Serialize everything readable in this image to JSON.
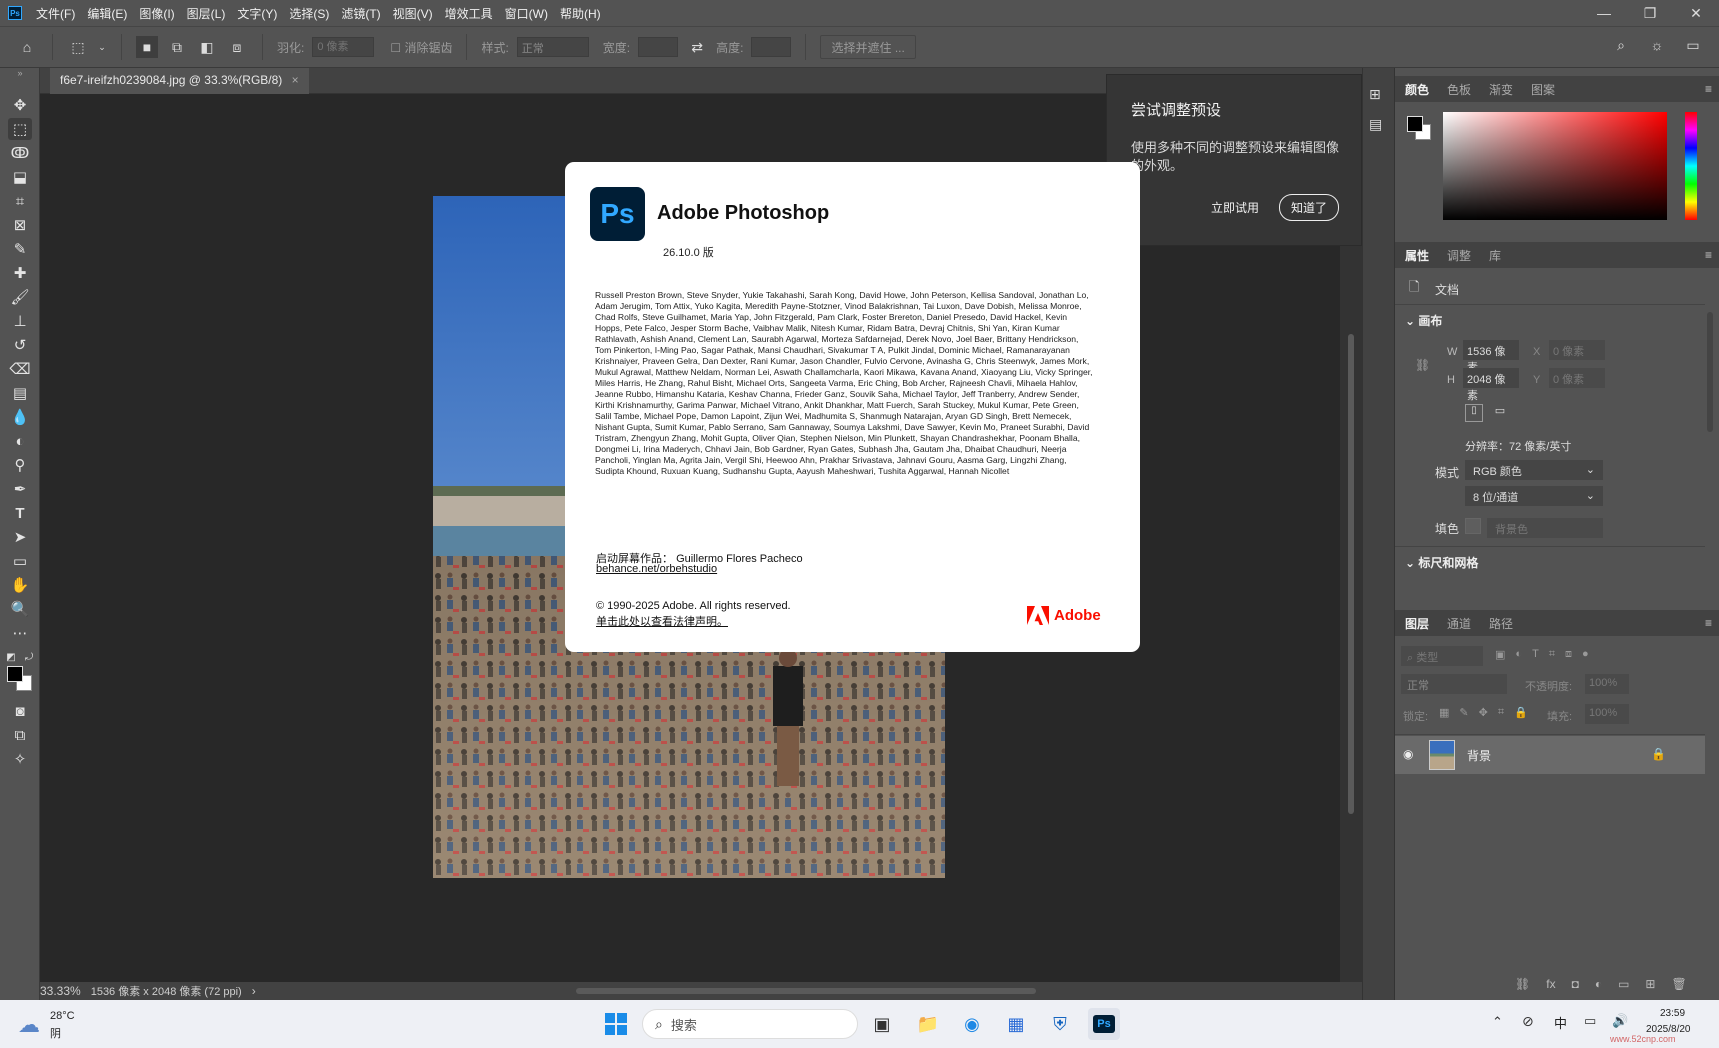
{
  "colors": {
    "ps_blue": "#31a8ff",
    "ps_dark": "#001e36",
    "adobe_red": "#fa0f00",
    "panel": "#535353",
    "canvas_bg": "#282828"
  },
  "menubar": {
    "logo": "Ps",
    "items": [
      "文件(F)",
      "编辑(E)",
      "图像(I)",
      "图层(L)",
      "文字(Y)",
      "选择(S)",
      "滤镜(T)",
      "视图(V)",
      "增效工具",
      "窗口(W)",
      "帮助(H)"
    ],
    "window_controls": [
      "—",
      "❐",
      "✕"
    ]
  },
  "options": {
    "feather_label": "羽化:",
    "feather_placeholder": "0 像素",
    "antialias_label": "消除锯齿",
    "style_label": "样式:",
    "style_value": "正常",
    "width_label": "宽度:",
    "height_label": "高度:",
    "select_mask_label": "选择并遮住 ..."
  },
  "document": {
    "tab_title": "f6e7-ireifzh0239084.jpg @ 33.3%(RGB/8)",
    "tab_close": "×"
  },
  "status": {
    "zoom": "33.33%",
    "info": "1536 像素 x 2048 像素 (72 ppi)",
    "arrow": "›"
  },
  "tooltip": {
    "title": "尝试调整预设",
    "body": "使用多种不同的调整预设来编辑图像的外观。",
    "try_label": "立即试用",
    "ok_label": "知道了"
  },
  "about": {
    "logo_text": "Ps",
    "app_name": "Adobe Photoshop",
    "version": "26.10.0 版",
    "credits": "Russell Preston Brown, Steve Snyder, Yukie Takahashi, Sarah Kong, David Howe, John Peterson, Kellisa Sandoval, Jonathan Lo, Adam Jerugim, Tom Attix, Yuko Kagita, Meredith Payne-Stotzner, Vinod Balakrishnan, Tai Luxon, Dave Dobish, Melissa Monroe, Chad Rolfs, Steve Guilhamet, Maria Yap, John Fitzgerald, Pam Clark, Foster Brereton, Daniel Presedo, David Hackel, Kevin Hopps, Pete Falco, Jesper Storm Bache, Vaibhav Malik, Nitesh Kumar, Ridam Batra, Devraj Chitnis, Shi Yan, Kiran Kumar Rathlavath, Ashish Anand, Clement Lan, Saurabh Agarwal, Morteza Safdarnejad, Derek Novo, Joel Baer, Brittany Hendrickson, Tom Pinkerton, I-Ming Pao, Sagar Pathak, Mansi Chaudhari, Sivakumar T A, Pulkit Jindal, Dominic Michael, Ramanarayanan Krishnaiyer, Praveen Gelra, Dan Dexter, Rani Kumar, Jason Chandler, Fulvio Cervone, Avinasha G, Chris Steenwyk, James Mork, Mukul Agrawal, Matthew Neldam, Norman Lei, Aswath Challamcharla, Kaori Mikawa, Kavana Anand, Xiaoyang Liu, Vicky Springer, Miles Harris, He Zhang, Rahul Bisht, Michael Orts, Sangeeta Varma, Eric Ching, Bob Archer, Rajneesh Chavli, Mihaela Hahlov, Jeanne Rubbo, Himanshu Kataria, Keshav Channa, Frieder Ganz, Souvik Saha, Michael Taylor, Jeff Tranberry, Andrew Sender, Kirthi Krishnamurthy, Garima Panwar, Michael Vitrano, Ankit Dhankhar, Matt Fuerch, Sarah Stuckey, Mukul Kumar, Pete Green, Salil Tambe, Michael Pope, Damon Lapoint, Zijun Wei, Madhumita S, Shanmugh Natarajan, Aryan GD Singh, Brett Nemecek, Nishant Gupta, Sumit Kumar, Pablo Serrano, Sam Gannaway, Soumya Lakshmi, Dave Sawyer, Kevin Mo, Praneet Surabhi, David Tristram, Zhengyun Zhang, Mohit Gupta, Oliver Qian, Stephen Nielson, Min Plunkett, Shayan Chandrashekhar, Poonam Bhalla, Dongmei Li, Irina Maderych, Chhavi Jain, Bob Gardner, Ryan Gates, Subhash Jha, Gautam Jha, Dhaibat Chaudhuri, Neerja Pancholi, Yinglan Ma, Agrita Jain, Vergil Shi, Heewoo Ahn, Prakhar Srivastava, Jahnavi Gouru, Aasma Garg, Lingzhi Zhang, Sudipta Khound, Ruxuan Kuang, Sudhanshu Gupta, Aayush Maheshwari, Tushita Aggarwal, Hannah Nicollet",
    "splash_label": "启动屏幕作品：",
    "splash_artist": "Guillermo Flores Pacheco",
    "splash_link": "behance.net/orbehstudio",
    "copyright": "© 1990-2025 Adobe. All rights reserved.",
    "legal_link": "单击此处以查看法律声明。",
    "adobe_label": "Adobe"
  },
  "panels": {
    "color_tabs": [
      "颜色",
      "色板",
      "渐变",
      "图案"
    ],
    "props_tabs": [
      "属性",
      "调整",
      "库"
    ],
    "doc_label": "文档",
    "canvas_section": "画布",
    "w_label": "W",
    "w_value": "1536 像素",
    "h_label": "H",
    "h_value": "2048 像素",
    "x_label": "X",
    "x_placeholder": "0 像素",
    "y_label": "Y",
    "y_placeholder": "0 像素",
    "resolution": "分辨率：72 像素/英寸",
    "mode_label": "模式",
    "mode_value": "RGB 颜色",
    "depth_value": "8 位/通道",
    "fill_label": "填色",
    "fill_value": "背景色",
    "rulers_section": "标尺和网格",
    "layer_tabs": [
      "图层",
      "通道",
      "路径"
    ],
    "filter_placeholder": "类型",
    "blend_value": "正常",
    "opacity_label": "不透明度:",
    "opacity_value": "100%",
    "lock_label": "锁定:",
    "fill2_label": "填充:",
    "fill2_value": "100%",
    "layer_name": "背景"
  },
  "taskbar": {
    "weather_temp": "28°C",
    "weather_desc": "阴",
    "search_placeholder": "搜索",
    "ime": "中",
    "time": "23:59",
    "date": "2025/8/20",
    "watermark": "www.52cnp.com"
  }
}
